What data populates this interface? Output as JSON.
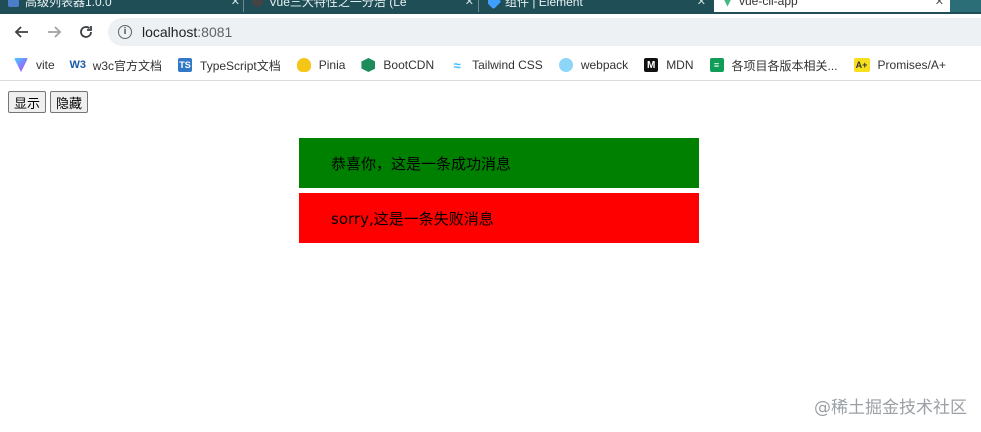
{
  "browser": {
    "tabs": [
      {
        "label": "高级列表器1.0.0",
        "active": false
      },
      {
        "label": "Vue三大特性之一分治 (Le",
        "active": false
      },
      {
        "label": "组件 | Element",
        "active": false
      },
      {
        "label": "vue-cli-app",
        "active": true
      }
    ],
    "url_host": "localhost",
    "url_port": ":8081",
    "bookmarks": [
      {
        "label": "vite",
        "icon": "vite-icon",
        "color": "#8f6cf0"
      },
      {
        "label": "w3c官方文档",
        "icon": "w3c-icon",
        "color": "#1a5aa6"
      },
      {
        "label": "TypeScript文档",
        "icon": "typescript-icon",
        "color": "#3178c6"
      },
      {
        "label": "Pinia",
        "icon": "pinia-icon",
        "color": "#f5c518"
      },
      {
        "label": "BootCDN",
        "icon": "bootcdn-icon",
        "color": "#1b8c5a"
      },
      {
        "label": "Tailwind CSS",
        "icon": "tailwind-icon",
        "color": "#38bdf8"
      },
      {
        "label": "webpack",
        "icon": "webpack-icon",
        "color": "#8dd6f9"
      },
      {
        "label": "MDN",
        "icon": "mdn-icon",
        "color": "#111111"
      },
      {
        "label": "各项目各版本相关...",
        "icon": "sheets-icon",
        "color": "#0f9d58"
      },
      {
        "label": "Promises/A+",
        "icon": "promises-icon",
        "color": "#f7df1e"
      }
    ]
  },
  "page": {
    "show_button": "显示",
    "hide_button": "隐藏",
    "messages": [
      {
        "text": "恭喜你，这是一条成功消息",
        "color": "#008000"
      },
      {
        "text": "sorry,这是一条失败消息",
        "color": "#ff0000"
      }
    ],
    "watermark": "@稀土掘金技术社区"
  }
}
